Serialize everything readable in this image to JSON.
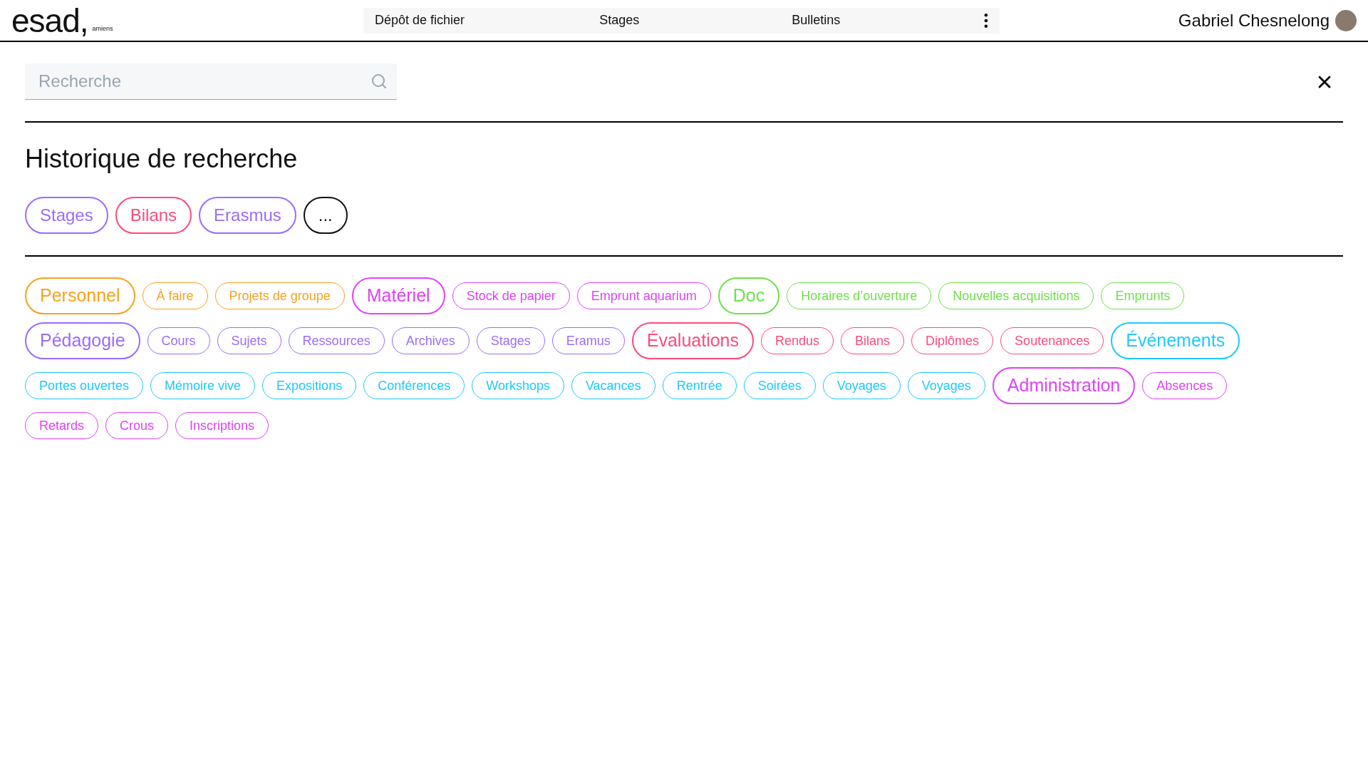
{
  "logo": {
    "mark": "esad,",
    "place": "amiens"
  },
  "nav": {
    "items": [
      {
        "label": "Dépôt de fichier"
      },
      {
        "label": "Stages"
      },
      {
        "label": "Bulletins"
      }
    ]
  },
  "user": {
    "name": "Gabriel Chesnelong"
  },
  "search": {
    "placeholder": "Recherche"
  },
  "history": {
    "title": "Historique de recherche",
    "items": [
      {
        "label": "Stages",
        "color": "#9b6bff"
      },
      {
        "label": "Bilans",
        "color": "#ff4a7a"
      },
      {
        "label": "Erasmus",
        "color": "#9b6bff"
      },
      {
        "label": "...",
        "color": "#111111"
      }
    ]
  },
  "tag_groups": [
    {
      "label": "Personnel",
      "color": "#f7a21b",
      "tags": [
        "À faire",
        "Projets de groupe"
      ]
    },
    {
      "label": "Matériel",
      "color": "#e040fb",
      "tags": [
        "Stock de papier",
        "Emprunt aquarium"
      ]
    },
    {
      "label": "Doc",
      "color": "#6ee04a",
      "tags": [
        "Horaires d’ouverture",
        "Nouvelles acquisitions",
        "Emprunts"
      ]
    },
    {
      "label": "Pédagogie",
      "color": "#9b6bff",
      "tags": [
        "Cours",
        "Sujets",
        "Ressources",
        "Archives",
        "Stages",
        "Eramus"
      ]
    },
    {
      "label": "Évaluations",
      "color": "#ff4a7a",
      "tags": [
        "Rendus",
        "Bilans",
        "Diplômes",
        "Soutenances"
      ]
    },
    {
      "label": "Événements",
      "color": "#1ec8ff",
      "tags": [
        "Portes ouvertes",
        "Mémoire vive",
        "Expositions",
        "Conférences",
        "Workshops",
        "Vacances",
        "Rentrée",
        "Soirées",
        "Voyages",
        "Voyages"
      ]
    },
    {
      "label": "Administration",
      "color": "#e040fb",
      "tags": [
        "Absences",
        "Retards",
        "Crous",
        "Inscriptions"
      ]
    }
  ]
}
